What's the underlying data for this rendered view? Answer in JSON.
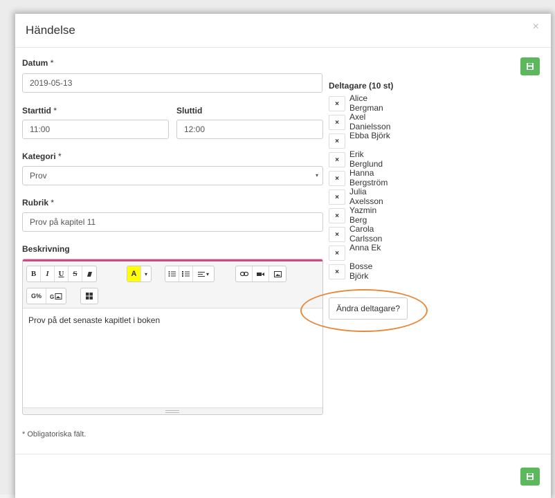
{
  "modal": {
    "title": "Händelse",
    "close": "×"
  },
  "form": {
    "date_label": "Datum",
    "required_mark": "*",
    "date_value": "2019-05-13",
    "start_label": "Starttid",
    "start_value": "11:00",
    "end_label": "Sluttid",
    "end_value": "12:00",
    "category_label": "Kategori",
    "category_value": "Prov",
    "heading_label": "Rubrik",
    "heading_value": "Prov på kapitel 11",
    "description_label": "Beskrivning",
    "description_value": "Prov på det senaste kapitlet i boken",
    "footnote": "* Obligatoriska fält."
  },
  "participants": {
    "title": "Deltagare (10 st)",
    "names": [
      "Alice Bergman",
      "Axel Danielsson",
      "Ebba Björk",
      "Erik Berglund",
      "Hanna Bergström",
      "Julia Axelsson",
      "Yazmin Berg",
      "Carola Carlsson",
      "Anna Ek",
      "Bosse Björk"
    ],
    "remove_glyph": "×",
    "change_button": "Ändra deltagare?"
  },
  "toolbar": {
    "bold": "B",
    "italic": "I",
    "underline": "U",
    "strike": "S",
    "color": "A",
    "caret": "▾"
  },
  "colors": {
    "save": "#5cb85c",
    "highlight": "#e8883a",
    "editor_accent": "#d6467f"
  }
}
